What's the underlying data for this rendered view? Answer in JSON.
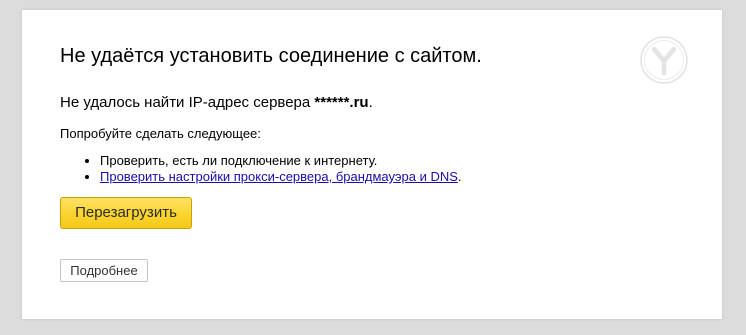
{
  "error": {
    "title": "Не удаётся установить соединение с сайтом.",
    "summary_prefix": "Не удалось найти IP-адрес сервера ",
    "server": "******.ru",
    "summary_suffix": ".",
    "suggest_heading": "Попробуйте сделать следующее:",
    "suggestions": [
      {
        "text": "Проверить, есть ли подключение к интернету."
      },
      {
        "link_text": "Проверить настройки прокси-сервера, брандмауэра и DNS",
        "suffix": "."
      }
    ]
  },
  "buttons": {
    "reload_label": "Перезагрузить",
    "details_label": "Подробнее"
  },
  "logo": {
    "icon": "yandex-browser-logo-icon"
  },
  "colors": {
    "background": "#dcdcdc",
    "card": "#ffffff",
    "reload_button": "#fbd42f",
    "link": "#1a0dab"
  }
}
